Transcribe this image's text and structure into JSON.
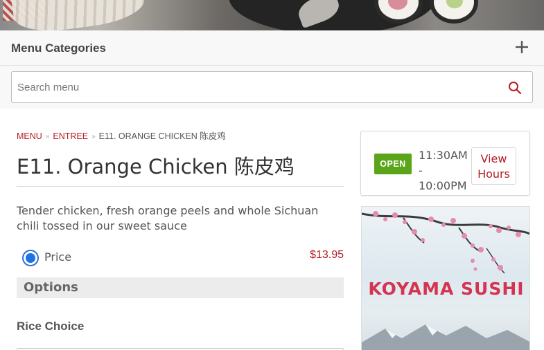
{
  "colors": {
    "accent": "#b21d24",
    "open_badge": "#5aa51a",
    "radio": "#1a73e8",
    "logo_text": "#d4344f"
  },
  "categories": {
    "title": "Menu Categories",
    "toggle_icon": "plus-icon"
  },
  "search": {
    "placeholder": "Search menu",
    "value": "",
    "icon": "search-icon"
  },
  "breadcrumb": {
    "items": [
      "MENU",
      "ENTREE"
    ],
    "current": "E11. ORANGE CHICKEN 陈皮鸡"
  },
  "item": {
    "title": "E11. Orange Chicken 陈皮鸡",
    "description": "Tender chicken, fresh orange peels and whole Sichuan chili tossed in our sweet sauce",
    "price_label": "Price",
    "price_value": "$13.95",
    "price_selected": true
  },
  "options": {
    "heading": "Options",
    "groups": [
      {
        "label": "Rice Choice"
      }
    ]
  },
  "hours": {
    "status": "OPEN",
    "range": "11:30AM - 10:00PM",
    "button_label": "View Hours"
  },
  "logo": {
    "text": "KOYAMA SUSHI"
  }
}
